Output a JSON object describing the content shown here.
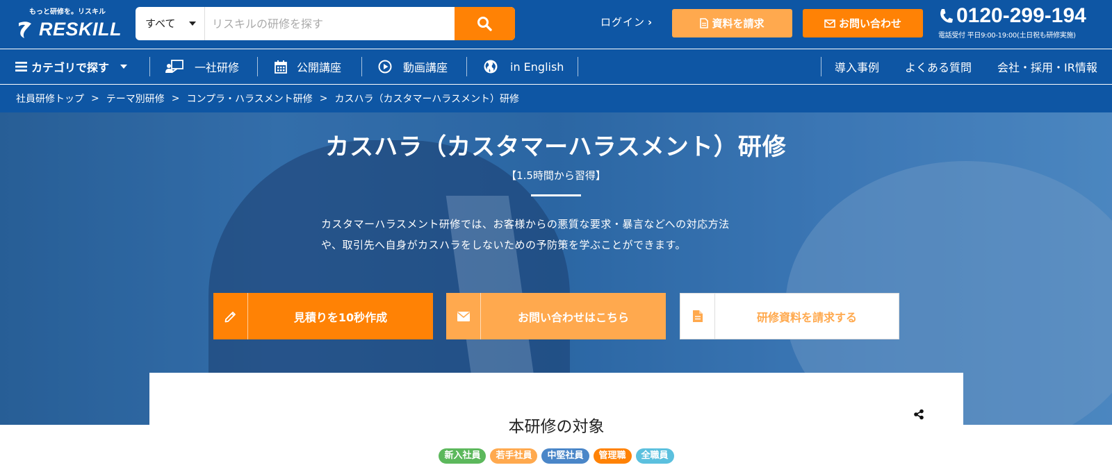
{
  "logo": {
    "tagline": "もっと研修を。リスキル",
    "name": "RESKILL"
  },
  "search": {
    "scope": "すべて",
    "placeholder": "リスキルの研修を探す"
  },
  "header": {
    "login": "ログイン",
    "request_docs": "資料を請求",
    "contact": "お問い合わせ",
    "phone": "0120-299-194",
    "hours": "電話受付 平日9:00-19:00(土日祝も研修実施)"
  },
  "nav": {
    "category": "カテゴリで探す",
    "items": [
      "一社研修",
      "公開講座",
      "動画講座",
      "in English"
    ],
    "right": [
      "導入事例",
      "よくある質問",
      "会社・採用・IR情報"
    ]
  },
  "breadcrumb": [
    "社員研修トップ",
    "テーマ別研修",
    "コンプラ・ハラスメント研修",
    "カスハラ（カスタマーハラスメント）研修"
  ],
  "hero": {
    "title": "カスハラ（カスタマーハラスメント）研修",
    "subtitle": "【1.5時間から習得】",
    "desc_line1": "カスタマーハラスメント研修では、お客様からの悪質な要求・暴言などへの対応方法",
    "desc_line2": "や、取引先へ自身がカスハラをしないための予防策を学ぶことができます。",
    "cta": [
      "見積りを10秒作成",
      "お問い合わせはこちら",
      "研修資料を請求する"
    ]
  },
  "target": {
    "heading": "本研修の対象",
    "badges": [
      {
        "label": "新入社員",
        "color": "#5cb85c"
      },
      {
        "label": "若手社員",
        "color": "#ffa94e"
      },
      {
        "label": "中堅社員",
        "color": "#4a86c8"
      },
      {
        "label": "管理職",
        "color": "#ff8205"
      },
      {
        "label": "全職員",
        "color": "#5bc0de"
      }
    ]
  },
  "colors": {
    "brand_blue": "#0e56a4",
    "accent_orange": "#ff8205",
    "light_orange": "#ffa94e"
  }
}
